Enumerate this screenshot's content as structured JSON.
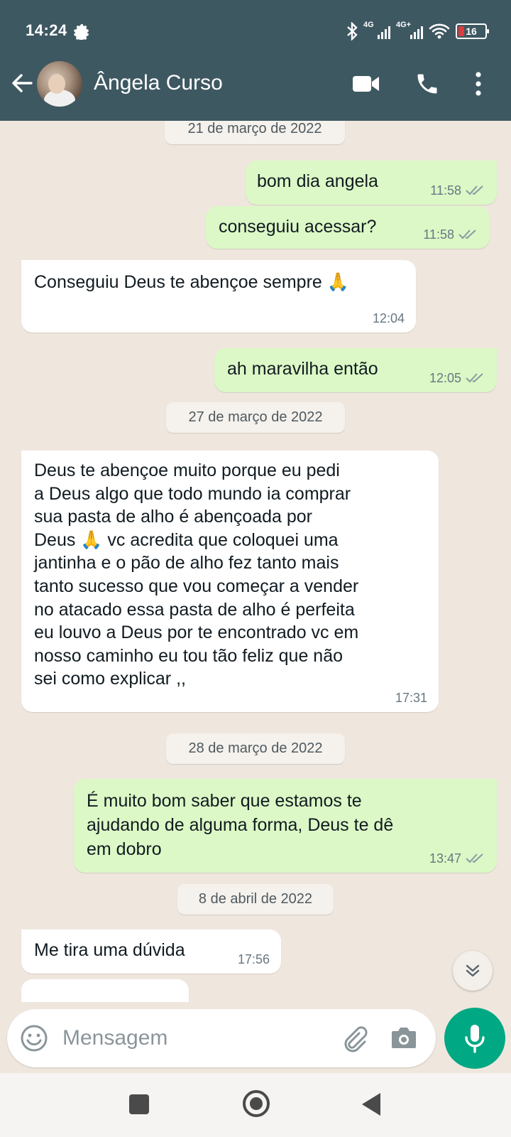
{
  "status_bar": {
    "time": "14:24",
    "network1": "4G",
    "network2": "4G+",
    "battery": "16"
  },
  "header": {
    "contact_name": "Ângela Curso"
  },
  "colors": {
    "header": "#3e5862",
    "outgoing": "#dcf8c6",
    "incoming": "#ffffff",
    "accent": "#00a884",
    "background": "#efe7de"
  },
  "messages": [
    {
      "type": "date",
      "text": "21 de março de 2022"
    },
    {
      "type": "out",
      "text": "bom dia angela",
      "time": "11:58",
      "read": true
    },
    {
      "type": "out",
      "text": "conseguiu acessar?",
      "time": "11:58",
      "read": true
    },
    {
      "type": "in",
      "text": "Conseguiu Deus te abençoe sempre 🙏",
      "time": "12:04"
    },
    {
      "type": "out",
      "text": "ah maravilha então",
      "time": "12:05",
      "read": true
    },
    {
      "type": "date",
      "text": "27 de março de 2022"
    },
    {
      "type": "in",
      "lines": [
        "Deus te abençoe muito porque eu pedi",
        "a Deus algo que todo mundo ia comprar",
        "sua pasta de alho é abençoada por",
        "Deus 🙏 vc acredita que coloquei uma",
        "jantinha e o pão de alho fez tanto mais",
        "tanto sucesso que vou começar a vender",
        "no atacado essa pasta de alho é perfeita",
        "eu louvo a Deus por te encontrado vc em",
        "nosso caminho eu tou tão feliz que não",
        "sei como explicar ,,"
      ],
      "time": "17:31"
    },
    {
      "type": "date",
      "text": "28 de março de 2022"
    },
    {
      "type": "out",
      "lines": [
        "É muito bom saber que estamos te",
        "ajudando de alguma forma, Deus te dê",
        "em dobro"
      ],
      "time": "13:47",
      "read": true
    },
    {
      "type": "date",
      "text": "8 de abril de 2022"
    },
    {
      "type": "in",
      "text": "Me tira uma dúvida",
      "time": "17:56"
    }
  ],
  "composer": {
    "placeholder": "Mensagem"
  }
}
